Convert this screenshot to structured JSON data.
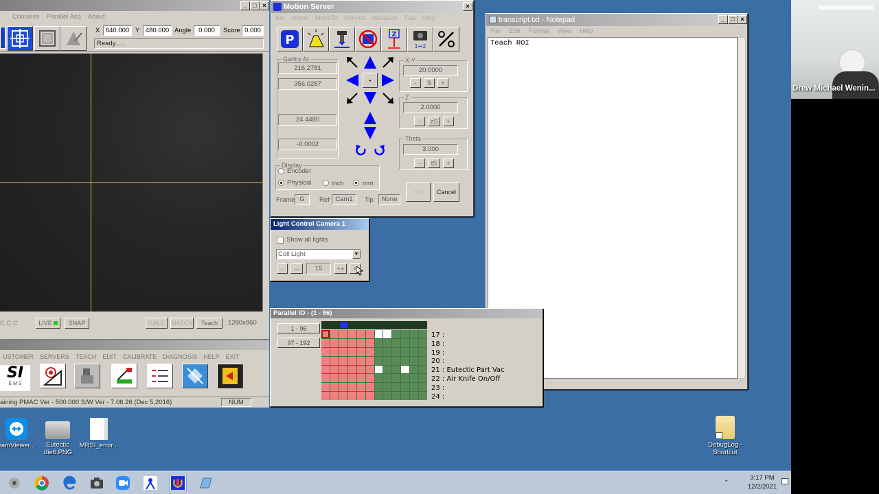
{
  "main_app": {
    "menu": [
      "Consoles",
      "Parallel Acq",
      "About"
    ],
    "coords": {
      "x_label": "X",
      "x_value": "640.000",
      "y_label": "Y",
      "y_value": "480.000",
      "angle_label": "Angle",
      "angle_value": "0.000",
      "score_label": "Score",
      "score_value": "0.000"
    },
    "status_field": "Ready.....",
    "buttons": {
      "live": "LIVE",
      "snap": "SNAP",
      "calc": "CALC",
      "match": "MATCH",
      "teach": "Teach"
    },
    "resolution": "1280x960",
    "bottom_menu": [
      "USTOMER",
      "SERVERS",
      "TEACH",
      "EDIT",
      "CALIBRATE",
      "DIAGNOSIS",
      "HELP",
      "EXIT"
    ],
    "logo": "SI",
    "logo_sub": "E M S",
    "status_bar": "aining PMAC Ver - 500.000 S/W Ver - 7.06.26 (Dec 5,2016)",
    "num_indicator": "NUM"
  },
  "motion_server": {
    "title": "Motion Server",
    "menu": [
      "Set",
      "Home",
      "MoveTo",
      "Service",
      "Advance",
      "Trial",
      "Help"
    ],
    "gantry_label": "Gantry At",
    "gantry_values": [
      "216.2781",
      "356.0287",
      "24.4480",
      "-0.0002"
    ],
    "xy_label": "X-Y",
    "xy_step": "20.0000",
    "xy_buttons": [
      "-",
      "S",
      "+"
    ],
    "z_label": "Z",
    "z_step": "2.0000",
    "z_buttons": [
      "-",
      "zS",
      "+"
    ],
    "theta_label": "Theta",
    "theta_step": "3.000",
    "theta_buttons": [
      "-",
      "tS",
      "+"
    ],
    "display_label": "Display",
    "encoder_label": "Encoder",
    "physical_label": "Physical",
    "inch_label": "inch",
    "mm_label": "mm",
    "frame_label": "Frame",
    "frame_value": "G",
    "ref_label": "Ref",
    "ref_value": "Cam1",
    "tip_label": "Tip",
    "tip_value": "None",
    "ok_label": "OK",
    "cancel_label": "Cancel",
    "icon_colors": {
      "p_button": "#1a2fd6",
      "arrow": "#0000ff"
    }
  },
  "light_control": {
    "title": "Light Control Camera 1",
    "show_all_label": "Show all lights",
    "dropdown_value": "Coll Light",
    "buttons": [
      "-",
      "--",
      "++",
      "+"
    ],
    "value": "15"
  },
  "parallel_io": {
    "title": "Parallel IO - (1 - 96)",
    "range_buttons": [
      "1 - 96",
      "97 - 192"
    ],
    "signals": [
      "17 :",
      "18 :",
      "19 :",
      "20 :",
      "21 : Eutectic Part Vac",
      "22 : Air Knife On/Off",
      "23 :",
      "24 :"
    ],
    "colors": {
      "off_red": "#f08080",
      "green": "#5a8a5a",
      "active": "#ffffff",
      "selected": "#c00000"
    }
  },
  "notepad": {
    "title": "transcript.txt - Notepad",
    "menu": [
      "File",
      "Edit",
      "Format",
      "View",
      "Help"
    ],
    "content": "Teach ROI"
  },
  "video": {
    "participant_name": "Drew Michael Wenin..."
  },
  "desktop_icons": [
    {
      "label": "eamViewer...",
      "icon": "teamviewer-icon"
    },
    {
      "label": "Eutectic die6.PNG",
      "icon": "image-file-icon"
    },
    {
      "label": "MRSI_error...",
      "icon": "text-file-icon"
    },
    {
      "label": "DebugLog - Shortcut",
      "icon": "folder-shortcut-icon"
    }
  ],
  "taskbar": {
    "time": "3:17 PM",
    "date": "12/2/2021"
  }
}
